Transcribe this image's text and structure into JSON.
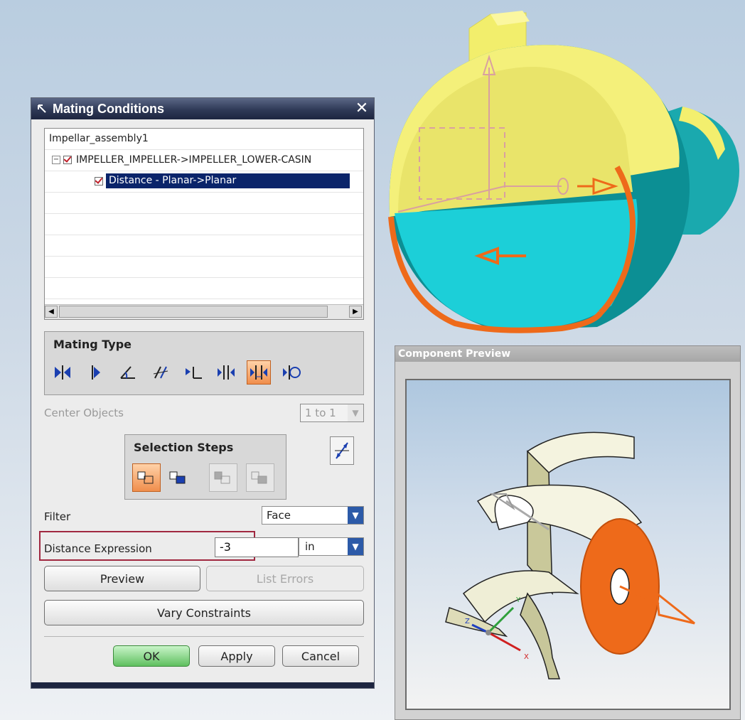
{
  "dialog": {
    "title": "Mating Conditions",
    "tree": {
      "root": "Impellar_assembly1",
      "child": "IMPELLER_IMPELLER->IMPELLER_LOWER-CASIN",
      "grandchild": "Distance - Planar->Planar"
    },
    "mating_type": {
      "label": "Mating Type",
      "icons": [
        "mate-icon",
        "align-icon",
        "angle-icon",
        "parallel-icon",
        "perpendicular-icon",
        "center-icon",
        "distance-icon",
        "tangent-icon"
      ],
      "active": "distance-icon"
    },
    "center_objects": {
      "label": "Center Objects",
      "value": "1 to 1"
    },
    "selection_steps": {
      "label": "Selection Steps",
      "steps": [
        "from-step-icon",
        "to-step-icon",
        "second-from-step-icon",
        "second-to-step-icon"
      ],
      "active": "from-step-icon"
    },
    "filter": {
      "label": "Filter",
      "value": "Face"
    },
    "distance_expression": {
      "label": "Distance Expression",
      "value": "-3",
      "unit": "in"
    },
    "buttons": {
      "preview": "Preview",
      "list_errors": "List Errors",
      "vary_constraints": "Vary Constraints",
      "ok": "OK",
      "apply": "Apply",
      "cancel": "Cancel"
    }
  },
  "preview_window": {
    "title": "Component Preview",
    "axes": {
      "x": "X",
      "y": "Y",
      "z": "Z"
    }
  },
  "colors": {
    "title_bar": "#2f3a57",
    "selection": "#0a246a",
    "active_orange": "#f08e4c",
    "ok_green": "#5fbf5f",
    "highlight_red": "#a02840",
    "casing_yellow": "#f6f27a",
    "casing_cyan": "#1cc6cf",
    "edge_orange": "#ee6a1a"
  }
}
